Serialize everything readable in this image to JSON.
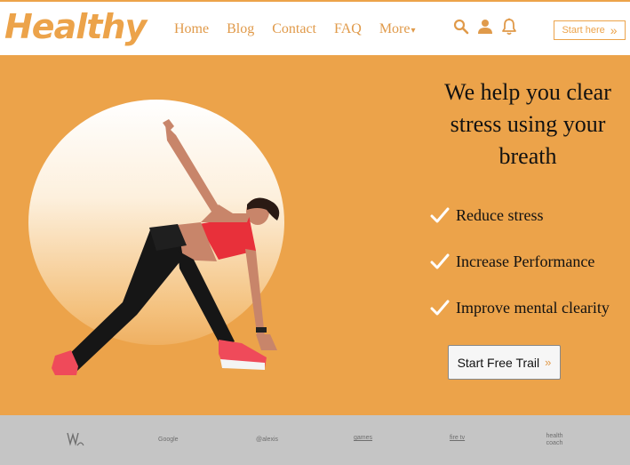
{
  "header": {
    "logo": "Healthy",
    "nav": [
      {
        "label": "Home"
      },
      {
        "label": "Blog"
      },
      {
        "label": "Contact"
      },
      {
        "label": "FAQ"
      },
      {
        "label": "More",
        "caret": "▾"
      }
    ],
    "icons": [
      "search-icon",
      "user-icon",
      "bell-icon"
    ],
    "start_here": {
      "label": "Start here",
      "arrow": "»"
    }
  },
  "hero": {
    "headline": "We help you clear stress using your breath",
    "features": [
      {
        "icon": "check-icon",
        "label": "Reduce stress"
      },
      {
        "icon": "check-icon",
        "label": "Increase Performance"
      },
      {
        "icon": "check-icon",
        "label": "Improve mental clearity"
      }
    ],
    "cta": {
      "label": "Start Free Trail",
      "arrow": "»"
    }
  },
  "partners": [
    {
      "name": "wa-logo",
      "label": ""
    },
    {
      "name": "google-logo",
      "label": "Google"
    },
    {
      "name": "alexis-logo",
      "label": "@alexis"
    },
    {
      "name": "games-logo",
      "label": "games"
    },
    {
      "name": "firetv-logo",
      "label": "fire tv"
    },
    {
      "name": "health-coach-logo",
      "label": "health coach"
    }
  ],
  "colors": {
    "accent": "#eca34a",
    "hero_bg": "#eca34a",
    "partner_bar": "#c5c5c5",
    "text": "#111111"
  }
}
